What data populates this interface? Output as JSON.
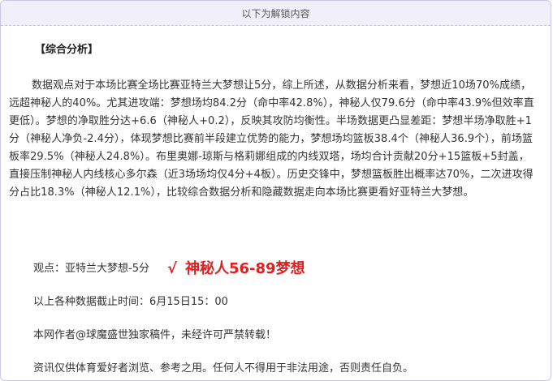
{
  "header": {
    "unlock_text": "以下为解锁内容"
  },
  "analysis": {
    "title": "【综合分析】",
    "paragraph": "数据观点对于本场比赛全场比赛亚特兰大梦想让5分，综上所述，从数据分析来看，梦想近10场70%成绩，远超神秘人的40%。尤其进攻端：梦想场均84.2分（命中率42.8%），神秘人仅79.6分（命中率43.9%但效率直更低）。梦想的净取胜分达+6.6（神秘人+0.2），反映其攻防均衡性。半场数据更凸显差距：梦想半场净取胜+1分（神秘人净负-2.4分），体现梦想比赛前半段建立优势的能力，梦想场均篮板38.4个（神秘人36.9个），前场篮板率29.5%（神秘人24.8%）。布里奥娜-琼斯与格莉娜组成的内线双塔，场均合计贡献20分+15篮板+5封盖，直接压制神秘人内线核心多尔森（近3场场均仅4分+4板）。历史交锋中，梦想篮板胜出概率达70%，二次进攻得分占比18.3%（神秘人12.1%），比较综合数据分析和隐藏数据走向本场比赛更看好亚特兰大梦想。"
  },
  "prediction": {
    "label": "观点：亚特兰大梦想-5分",
    "check": "√",
    "result": "神秘人56-89梦想",
    "result_color": "#e02020"
  },
  "footer": {
    "deadline": "以上各种数据截止时间：6月15日15：00",
    "author": "本网作者@球魔盛世独家稿件，未经许可严禁转载！",
    "disclaimer": "资讯仅供体育爱好者浏览、参考之用。任何人不得用于非法用途，否则责任自负。"
  },
  "colors": {
    "header_bg": "#f1eff9",
    "border": "#ccc6e6",
    "highlight": "#e02020"
  }
}
